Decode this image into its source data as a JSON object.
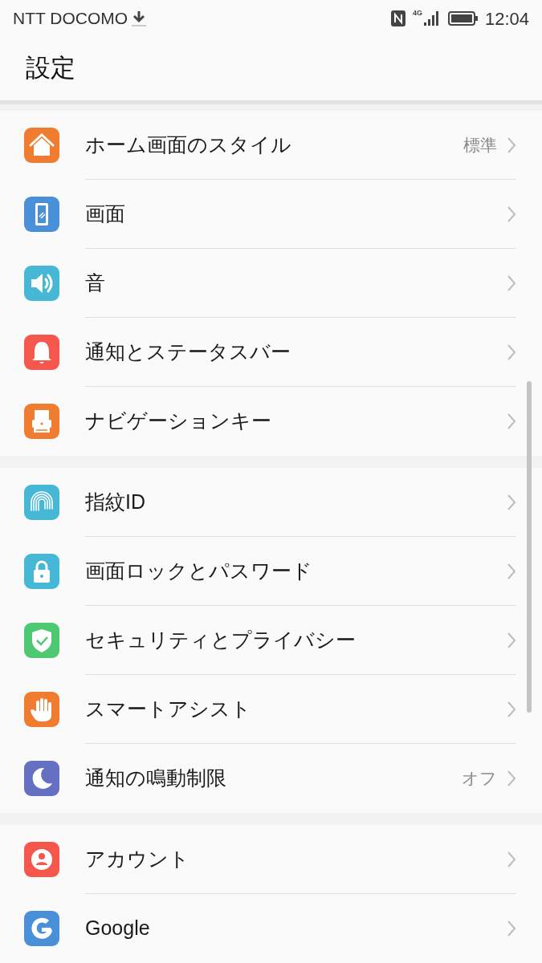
{
  "status_bar": {
    "carrier": "NTT DOCOMO",
    "network": "4G",
    "time": "12:04"
  },
  "header": {
    "title": "設定"
  },
  "groups": [
    {
      "items": [
        {
          "label": "ホーム画面のスタイル",
          "value": "標準",
          "color": "#f07c2f"
        },
        {
          "label": "画面",
          "color": "#4a90d9"
        },
        {
          "label": "音",
          "color": "#46b8d6"
        },
        {
          "label": "通知とステータスバー",
          "color": "#f5574d"
        },
        {
          "label": "ナビゲーションキー",
          "color": "#f07c2f"
        }
      ]
    },
    {
      "items": [
        {
          "label": "指紋ID",
          "color": "#46b8d6"
        },
        {
          "label": "画面ロックとパスワード",
          "color": "#46b8d6"
        },
        {
          "label": "セキュリティとプライバシー",
          "color": "#4fc872"
        },
        {
          "label": "スマートアシスト",
          "color": "#f07c2f"
        },
        {
          "label": "通知の鳴動制限",
          "value": "オフ",
          "color": "#6570c2"
        }
      ]
    },
    {
      "items": [
        {
          "label": "アカウント",
          "color": "#f5574d"
        },
        {
          "label": "Google",
          "color": "#4a90d9"
        }
      ]
    }
  ]
}
